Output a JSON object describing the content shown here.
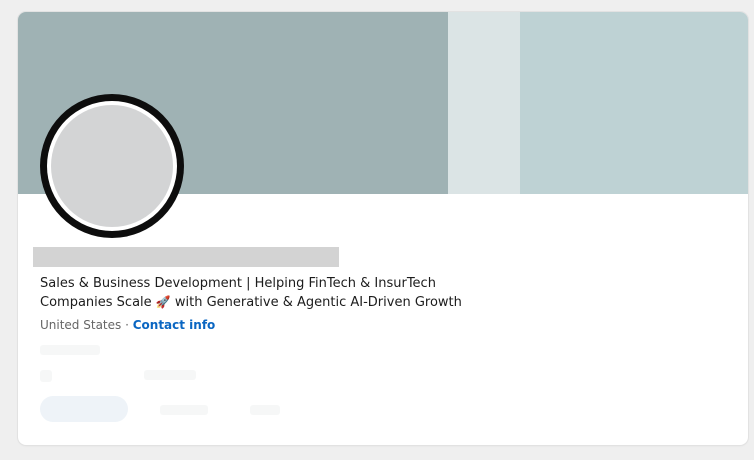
{
  "profile": {
    "headline_line1": "Sales & Business Development | Helping FinTech & InsurTech",
    "headline_line2_pre": "Companies Scale ",
    "headline_emoji": "🚀",
    "headline_line2_post": " with Generative & Agentic AI-Driven Growth",
    "location": "United States",
    "separator": " · ",
    "contact_info": "Contact info"
  },
  "colors": {
    "banner_dark": "#9fb2b4",
    "banner_light": "#dbe4e5",
    "banner_right": "#bed2d4",
    "link": "#0a66c2",
    "redaction": "#d3d3d3"
  }
}
